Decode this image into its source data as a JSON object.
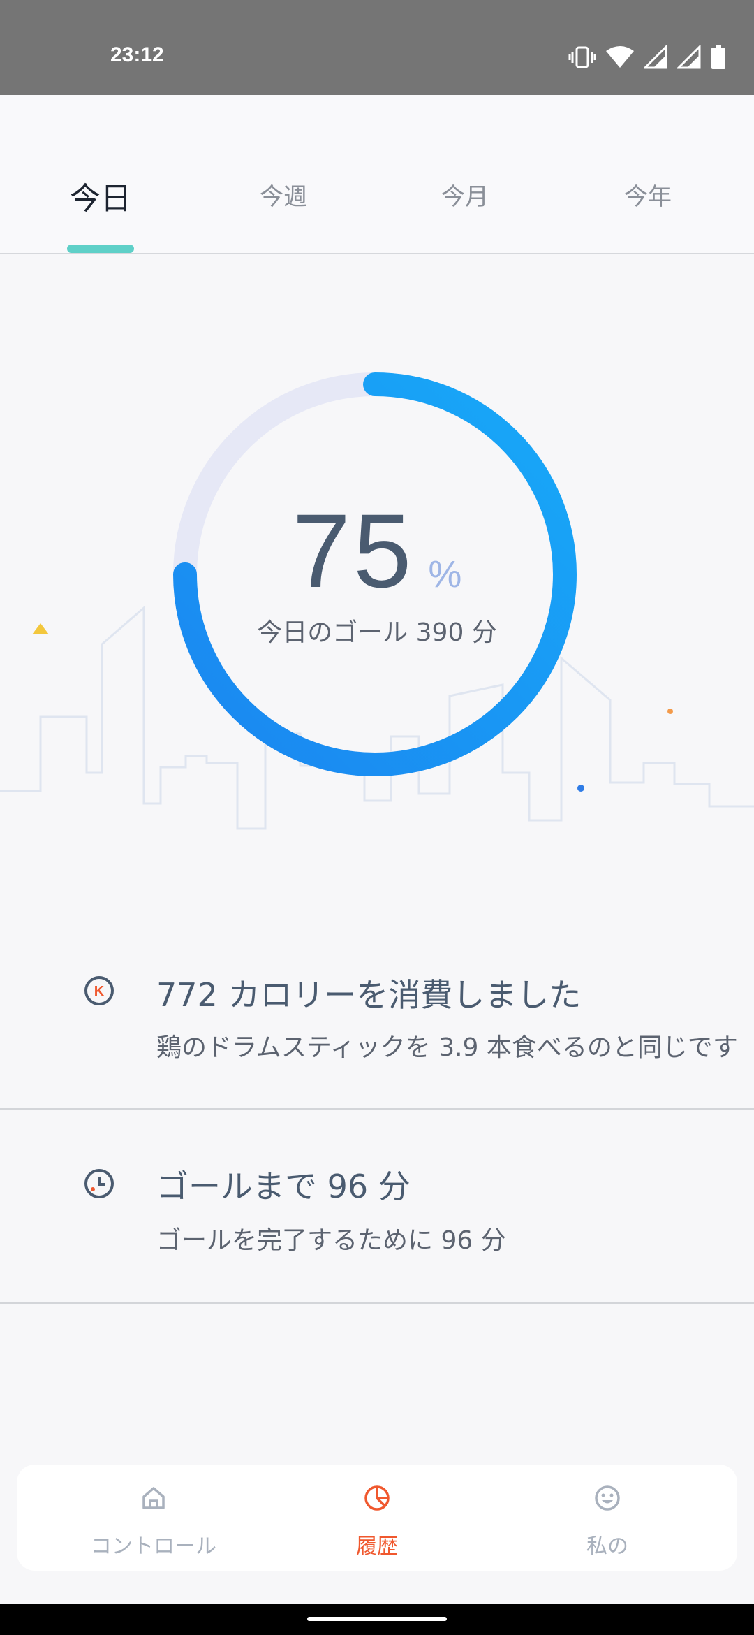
{
  "status_bar": {
    "time": "23:12"
  },
  "tabs": [
    {
      "label": "今日",
      "active": true
    },
    {
      "label": "今週",
      "active": false
    },
    {
      "label": "今月",
      "active": false
    },
    {
      "label": "今年",
      "active": false
    }
  ],
  "progress": {
    "value": "75",
    "unit": "%",
    "fraction": 0.75,
    "goal_text": "今日のゴール 390 分",
    "colors": {
      "track": "#e6e8f6",
      "start": "#1a86f0",
      "end": "#18a9f8"
    }
  },
  "info": [
    {
      "icon": "calorie-icon",
      "title": "772 カロリーを消費しました",
      "subtitle": "鶏のドラムスティックを 3.9 本食べるのと同じです"
    },
    {
      "icon": "clock-icon",
      "title": "ゴールまで 96 分",
      "subtitle": "ゴールを完了するために 96 分"
    }
  ],
  "bottom_nav": [
    {
      "label": "コントロール",
      "icon": "home-icon",
      "active": false
    },
    {
      "label": "履歴",
      "icon": "pie-chart-icon",
      "active": true
    },
    {
      "label": "私の",
      "icon": "smiley-icon",
      "active": false
    }
  ],
  "accent_color": "#f0582e"
}
